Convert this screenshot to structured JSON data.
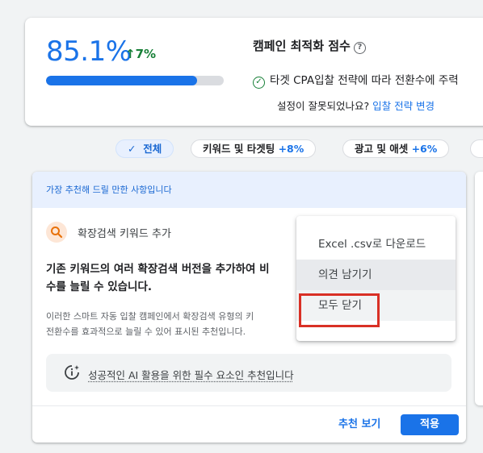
{
  "score": {
    "value": "85.1%",
    "delta": "↑7%",
    "progress_percent": 85.1
  },
  "summary": {
    "title": "캠페인 최적화 점수",
    "target_line_prefix": "타겟 CPA입찰 전략",
    "target_line_suffix": "에 따라 전환수에 주력",
    "settings_question": "설정이 잘못되었나요?",
    "settings_link": "입찰 전략 변경"
  },
  "filters": [
    {
      "label": "전체",
      "selected": true
    },
    {
      "label": "키워드 및 타겟팅",
      "plus": "+8%"
    },
    {
      "label": "광고 및 애셋",
      "plus": "+6%"
    }
  ],
  "recommendation": {
    "banner": "가장 추천해 드릴 만한 사항입니다",
    "title": "확장검색 키워드 추가",
    "desc_line1": "기존 키워드의 여러 확장검색 버전을 추가하여 비",
    "desc_line2": "수를 늘릴 수 있습니다.",
    "detail_line1": "이러한 스마트 자동 입찰 캠페인에서 확장검색 유형의 키",
    "detail_line2": "전환수를 효과적으로 늘릴 수 있어 표시된 추천입니다.",
    "ai_note": "성공적인 AI 활용을 위한 필수 요소인 추천입니다",
    "view_button": "추천 보기",
    "apply_button": "적용"
  },
  "menu": {
    "items": [
      "Excel .csv로 다운로드",
      "의견 남기기",
      "모두 닫기"
    ]
  },
  "colors": {
    "accent": "#1a73e8",
    "positive": "#188038",
    "highlight": "#d93025"
  }
}
